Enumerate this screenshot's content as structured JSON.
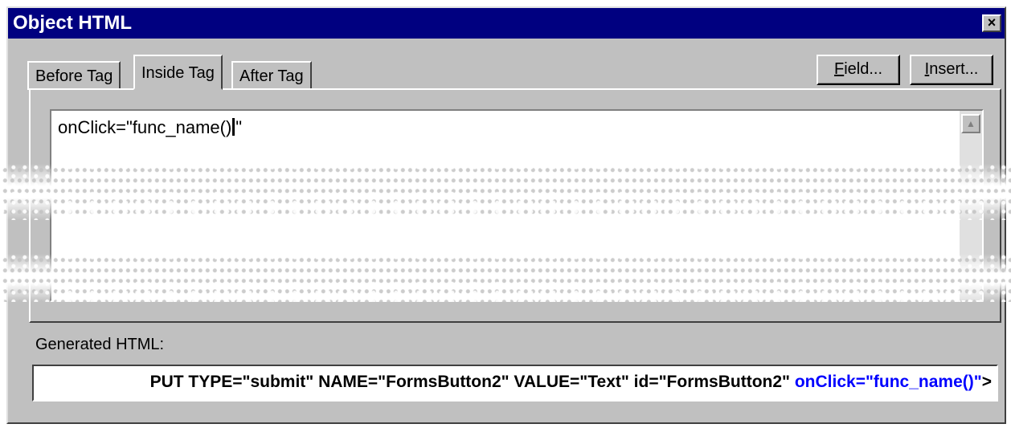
{
  "window": {
    "title": "Object HTML",
    "close_glyph": "×"
  },
  "tabs": [
    {
      "label": "Before Tag",
      "active": false
    },
    {
      "label": "Inside Tag",
      "active": true
    },
    {
      "label": "After Tag",
      "active": false
    }
  ],
  "buttons": {
    "field": {
      "underlined": "F",
      "rest": "ield..."
    },
    "insert": {
      "underlined": "I",
      "rest": "nsert..."
    }
  },
  "editor": {
    "text_before_caret": "onClick=\"func_name()",
    "text_after_caret": "\""
  },
  "generated": {
    "label": "Generated HTML:",
    "text_plain": "PUT TYPE=\"submit\" NAME=\"FormsButton2\" VALUE=\"Text\" id=\"FormsButton2\" ",
    "text_highlight": "onClick=\"func_name()\"",
    "text_end": ">"
  },
  "colors": {
    "titlebar": "#000080",
    "face": "#c0c0c0",
    "highlight_text": "#0000ff"
  },
  "icons": {
    "close": "close-icon",
    "scroll_up": "scroll-up-arrow-icon"
  }
}
